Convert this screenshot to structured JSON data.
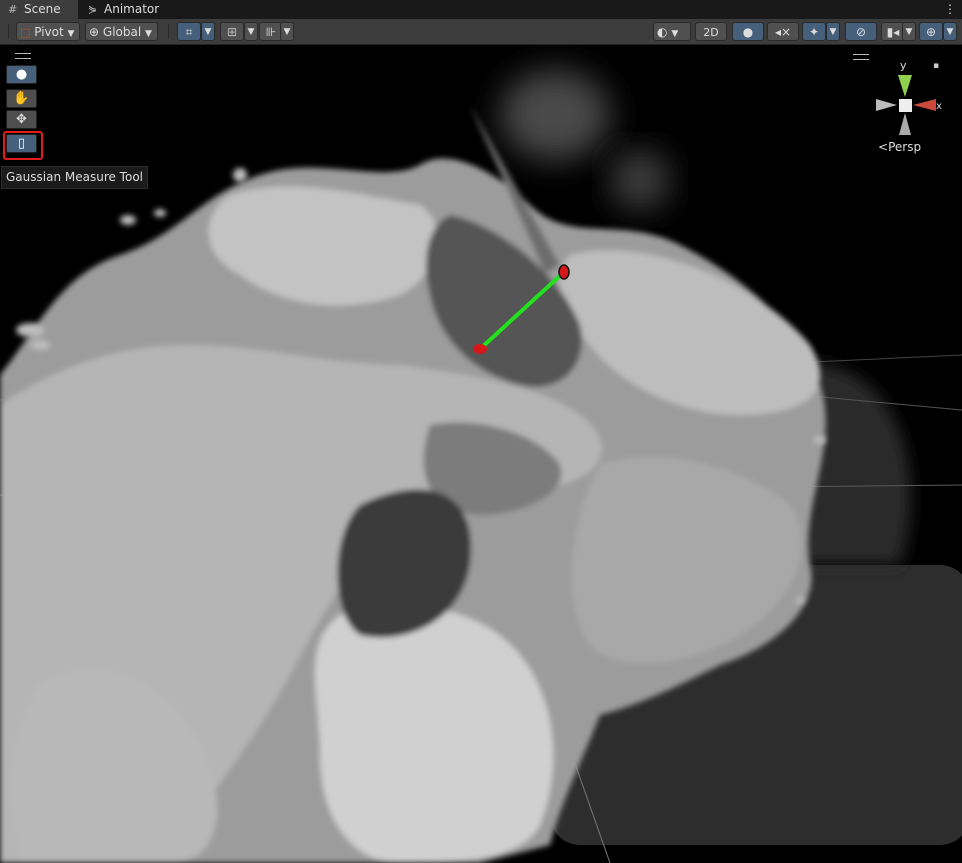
{
  "tabs": [
    {
      "label": "Scene",
      "icon": "grid-icon",
      "active": true
    },
    {
      "label": "Animator",
      "icon": "animator-icon",
      "active": false
    }
  ],
  "toolbar": {
    "pivot_label": "Pivot",
    "global_label": "Global",
    "two_d_label": "2D"
  },
  "tools": {
    "tooltip": "Gaussian Measure Tool"
  },
  "gizmo": {
    "y_label": "y",
    "x_label": "x",
    "persp_label": "Persp"
  },
  "colors": {
    "accent": "#46607c",
    "highlight": "#e21b1b",
    "measure_line": "#22e11e",
    "marker": "#d81818"
  }
}
